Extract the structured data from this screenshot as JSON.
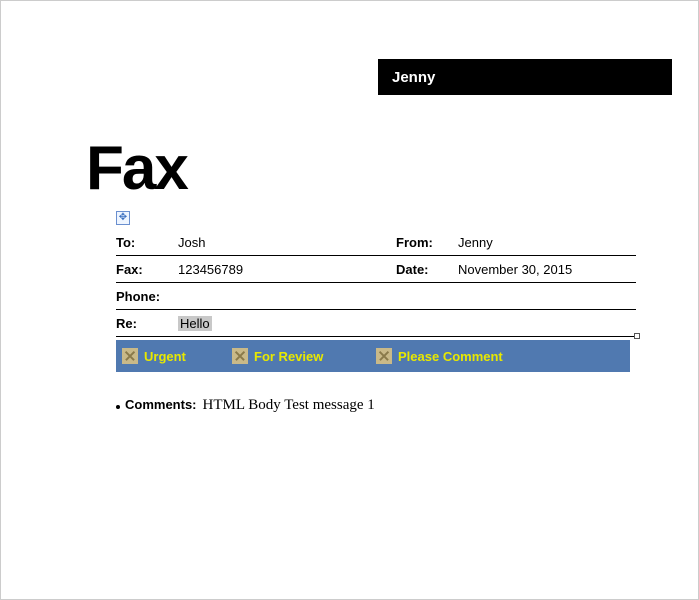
{
  "header": {
    "name": "Jenny"
  },
  "title": "Fax",
  "fields": {
    "to": {
      "label": "To:",
      "value": "Josh"
    },
    "from": {
      "label": "From:",
      "value": "Jenny"
    },
    "fax": {
      "label": "Fax:",
      "value": "123456789"
    },
    "date": {
      "label": "Date:",
      "value": "November 30, 2015"
    },
    "phone": {
      "label": "Phone:",
      "value": ""
    },
    "re": {
      "label": "Re:",
      "value": "Hello"
    }
  },
  "status": {
    "urgent": "Urgent",
    "review": "For Review",
    "comment": "Please Comment"
  },
  "comments": {
    "label": "Comments:",
    "value": "HTML Body Test message 1"
  }
}
